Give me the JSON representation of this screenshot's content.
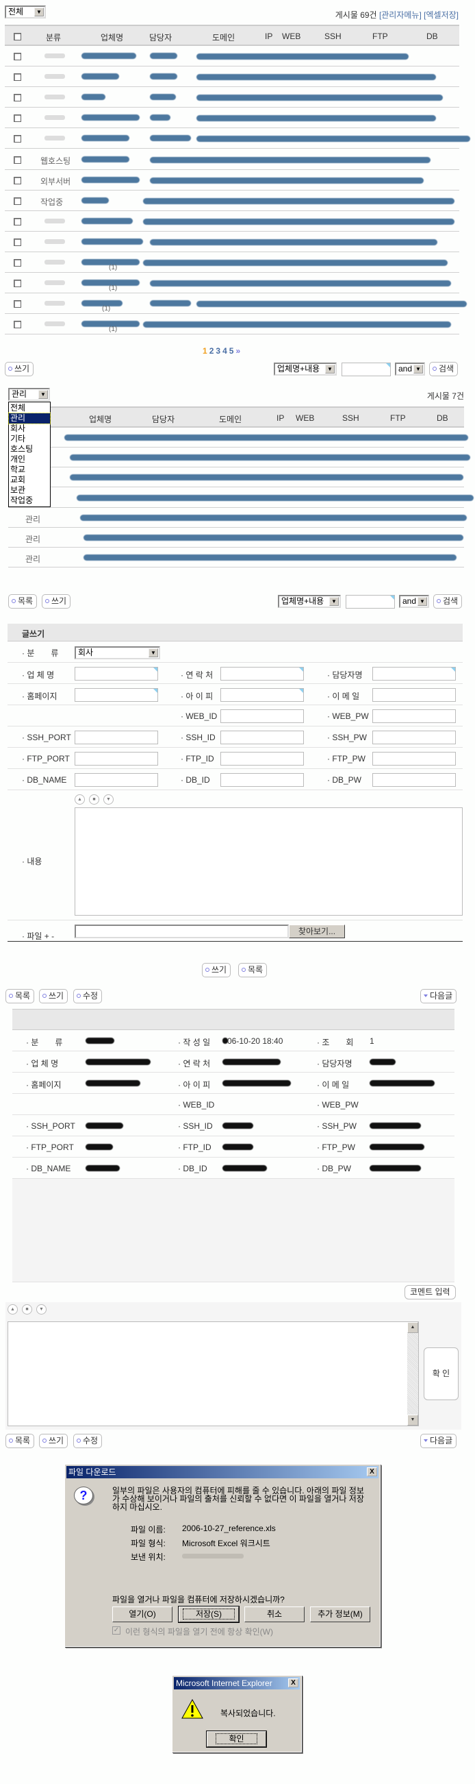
{
  "list1": {
    "filter_select": "전체",
    "count_text": "게시물 69건",
    "admin_link": "[관리자메뉴]",
    "excel_link": "[엑셀저장]",
    "headers": [
      "분류",
      "업체명",
      "담당자",
      "도메인",
      "IP",
      "WEB",
      "SSH",
      "FTP",
      "DB"
    ],
    "rows": [
      {
        "category": "",
        "comments": ""
      },
      {
        "category": "",
        "comments": ""
      },
      {
        "category": "",
        "comments": ""
      },
      {
        "category": "",
        "comments": ""
      },
      {
        "category": "",
        "comments": ""
      },
      {
        "category": "웹호스팅",
        "comments": ""
      },
      {
        "category": "외부서버",
        "comments": ""
      },
      {
        "category": "작업중",
        "comments": ""
      },
      {
        "category": "",
        "comments": ""
      },
      {
        "category": "",
        "comments": ""
      },
      {
        "category": "",
        "comments": "(1)"
      },
      {
        "category": "",
        "comments": "(1)"
      },
      {
        "category": "",
        "comments": "(1)"
      },
      {
        "category": "",
        "comments": "(1)"
      }
    ]
  },
  "pagination": {
    "pages": [
      "1",
      "2",
      "3",
      "4",
      "5"
    ],
    "next": "»",
    "current": "1"
  },
  "search": {
    "field": "업체명+내용",
    "op": "and",
    "query": ""
  },
  "buttons": {
    "write": "쓰기",
    "list": "목록",
    "edit": "수정",
    "search": "검색",
    "next_post": "다음글",
    "comment_input": "코멘트 입력",
    "confirm": "확 인",
    "browse": "찾아보기..."
  },
  "list2": {
    "filter_select": "관리",
    "count_text": "게시물 7건",
    "dropdown_options": [
      "전체",
      "관리",
      "회사",
      "기타",
      "호스팅",
      "개인",
      "학교",
      "교회",
      "보관",
      "작업중"
    ],
    "dropdown_selected": "관리",
    "headers": [
      "업체명",
      "담당자",
      "도메인",
      "IP",
      "WEB",
      "SSH",
      "FTP",
      "DB"
    ],
    "rows": [
      {
        "category": ""
      },
      {
        "category": ""
      },
      {
        "category": ""
      },
      {
        "category": ""
      },
      {
        "category": "관리"
      },
      {
        "category": "관리"
      },
      {
        "category": "관리"
      }
    ]
  },
  "form": {
    "title": "글쓰기",
    "category_label": "· 분　　류",
    "category_value": "회사",
    "rows": [
      [
        "· 업 체 명",
        "· 연 락 처",
        "· 담당자명"
      ],
      [
        "· 홈페이지",
        "· 아 이 피",
        "· 이 메 일"
      ],
      [
        "",
        "· WEB_ID",
        "· WEB_PW"
      ],
      [
        "· SSH_PORT",
        "· SSH_ID",
        "· SSH_PW"
      ],
      [
        "· FTP_PORT",
        "· FTP_ID",
        "· FTP_PW"
      ],
      [
        "· DB_NAME",
        "· DB_ID",
        "· DB_PW"
      ]
    ],
    "content_label": "· 내용",
    "file_label": "· 파일 + -"
  },
  "view": {
    "rows": [
      [
        "· 분　　류",
        "· 작 성 일",
        "· 조　　회"
      ],
      [
        "· 업 체 명",
        "· 연 락 처",
        "· 담당자명"
      ],
      [
        "· 홈페이지",
        "· 아 이 피",
        "· 이 메 일"
      ],
      [
        "",
        "· WEB_ID",
        "· WEB_PW"
      ],
      [
        "· SSH_PORT",
        "· SSH_ID",
        "· SSH_PW"
      ],
      [
        "· FTP_PORT",
        "· FTP_ID",
        "· FTP_PW"
      ],
      [
        "· DB_NAME",
        "· DB_ID",
        "· DB_PW"
      ]
    ],
    "date_value": "06-10-20 18:40",
    "views_value": "1"
  },
  "download_dialog": {
    "title": "파일 다운로드",
    "warning": "일부의 파일은 사용자의 컴퓨터에 피해를 줄 수 있습니다. 아래의 파일 정보가 수상해 보이거나 파일의 출처를 신뢰할 수 없다면 이 파일을 열거나 저장하지 마십시오.",
    "name_label": "파일 이름:",
    "name_value": "2006-10-27_reference.xls",
    "type_label": "파일 형식:",
    "type_value": "Microsoft Excel 워크시트",
    "from_label": "보낸 위치:",
    "question": "파일을 열거나 파일을 컴퓨터에 저장하시겠습니까?",
    "open": "열기(O)",
    "save": "저장(S)",
    "cancel": "취소",
    "more": "추가 정보(M)",
    "always_ask": "이런 형식의 파일을 열기 전에 항상 확인(W)"
  },
  "alert": {
    "title": "Microsoft Internet Explorer",
    "message": "복사되었습니다.",
    "ok": "확인"
  }
}
